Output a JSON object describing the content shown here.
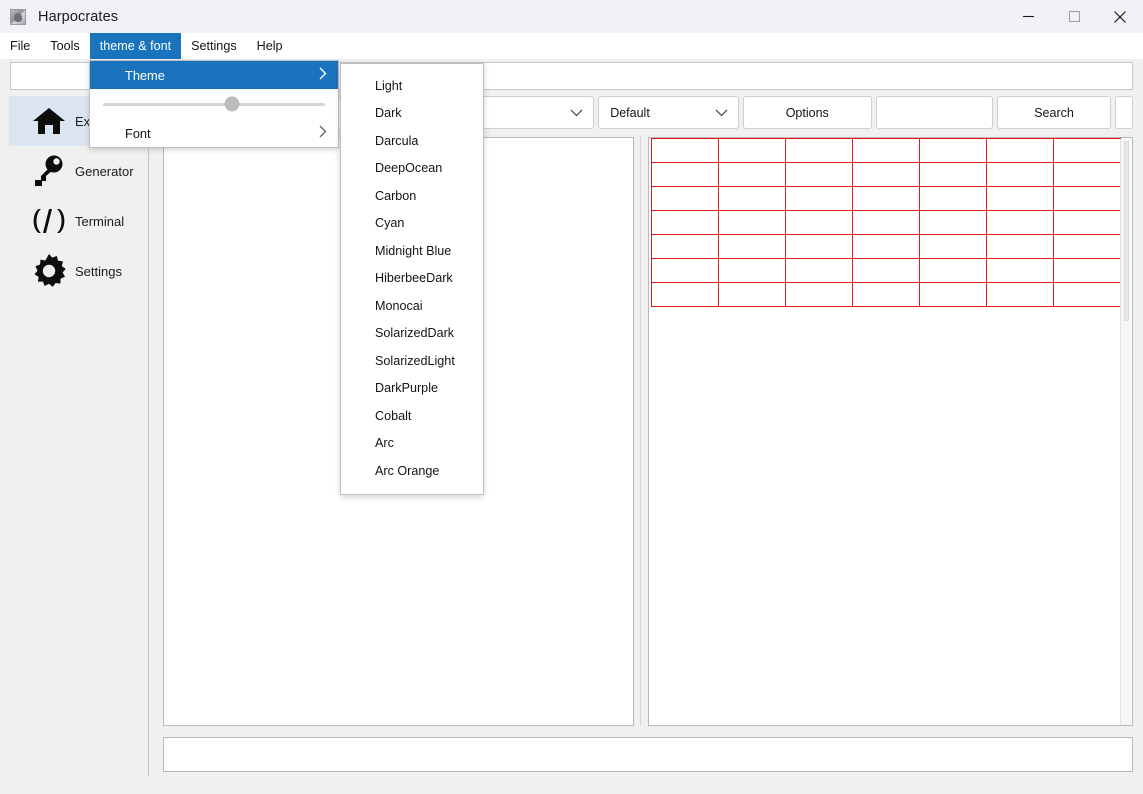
{
  "window": {
    "title": "Harpocrates",
    "icon": "app-icon",
    "controls": [
      {
        "name": "minimize-button",
        "glyph": "minimize-icon"
      },
      {
        "name": "maximize-button",
        "glyph": "maximize-icon"
      },
      {
        "name": "close-button",
        "glyph": "close-icon"
      }
    ]
  },
  "menubar": {
    "items": [
      {
        "label": "File",
        "active": false
      },
      {
        "label": "Tools",
        "active": false
      },
      {
        "label": "theme & font",
        "active": true
      },
      {
        "label": "Settings",
        "active": false
      },
      {
        "label": "Help",
        "active": false
      }
    ]
  },
  "top_input": {
    "value": "",
    "placeholder": ""
  },
  "sidebar": {
    "items": [
      {
        "label": "Explorer",
        "icon": "home-icon",
        "selected": true
      },
      {
        "label": "Generator",
        "icon": "key-icon",
        "selected": false
      },
      {
        "label": "Terminal",
        "icon": "code-icon",
        "selected": false
      },
      {
        "label": "Settings",
        "icon": "gear-icon",
        "selected": false
      }
    ]
  },
  "toolbar": {
    "search_field": {
      "value": "",
      "placeholder": ""
    },
    "combo_empty": {
      "value": "",
      "icon": "chevron-down-icon"
    },
    "combo_default": {
      "value": "Default",
      "icon": "chevron-down-icon"
    },
    "options_button": "Options",
    "blank_field": {
      "value": "",
      "placeholder": ""
    },
    "search_button": "Search"
  },
  "left_panel": {
    "content": ""
  },
  "table": {
    "columns": 7,
    "rows": 7,
    "grid_color": "#e41b1b",
    "cells": []
  },
  "bottom_bar": {
    "value": "",
    "placeholder": ""
  },
  "theme_font_menu": {
    "theme": {
      "label": "Theme",
      "highlighted": true,
      "arrow": "chevron-right-icon"
    },
    "slider": {
      "value": 58,
      "min": 0,
      "max": 100
    },
    "font": {
      "label": "Font",
      "highlighted": false,
      "arrow": "chevron-right-icon"
    }
  },
  "theme_submenu": {
    "items": [
      "Light",
      "Dark",
      "Darcula",
      "DeepOcean",
      "Carbon",
      "Cyan",
      "Midnight Blue",
      "HiberbeeDark",
      "Monocai",
      "SolarizedDark",
      "SolarizedLight",
      "DarkPurple",
      "Cobalt",
      "Arc",
      "Arc Orange"
    ]
  },
  "colors": {
    "accent": "#1a73bd",
    "titlebar": "#f3f1f7",
    "chrome": "#f0f0f0",
    "grid_red": "#e41b1b",
    "selection": "#dbe5f1"
  }
}
